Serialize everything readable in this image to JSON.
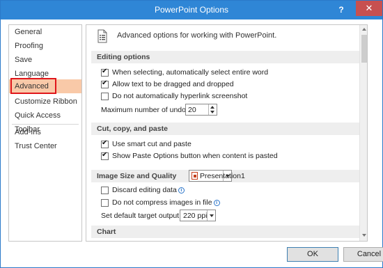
{
  "window": {
    "title": "PowerPoint Options",
    "help": "?",
    "close": "✕"
  },
  "sidebar": {
    "items": [
      {
        "label": "General"
      },
      {
        "label": "Proofing"
      },
      {
        "label": "Save"
      },
      {
        "label": "Language"
      },
      {
        "label": "Advanced",
        "active": true
      },
      {
        "label": "Customize Ribbon"
      },
      {
        "label": "Quick Access Toolbar"
      },
      {
        "label": "Add-Ins"
      },
      {
        "label": "Trust Center"
      }
    ]
  },
  "content": {
    "header": "Advanced options for working with PowerPoint.",
    "sections": {
      "editing": {
        "title": "Editing options",
        "options": [
          {
            "label": "When selecting, automatically select entire word",
            "checked": true
          },
          {
            "label": "Allow text to be dragged and dropped",
            "checked": true
          },
          {
            "label": "Do not automatically hyperlink screenshot",
            "checked": false
          }
        ],
        "undo_label": "Maximum number of undos:",
        "undo_value": "20"
      },
      "cut_copy_paste": {
        "title": "Cut, copy, and paste",
        "options": [
          {
            "label": "Use smart cut and paste",
            "checked": true
          },
          {
            "label": "Show Paste Options button when content is pasted",
            "checked": true
          }
        ]
      },
      "image": {
        "title": "Image Size and Quality",
        "presentation": "Presentation1",
        "options": [
          {
            "label": "Discard editing data",
            "checked": false
          },
          {
            "label": "Do not compress images in file",
            "checked": false
          }
        ],
        "ppi_label": "Set default target output to:",
        "ppi_value": "220 ppi"
      },
      "chart": {
        "title": "Chart"
      }
    }
  },
  "buttons": {
    "ok": "OK",
    "cancel": "Cancel"
  }
}
